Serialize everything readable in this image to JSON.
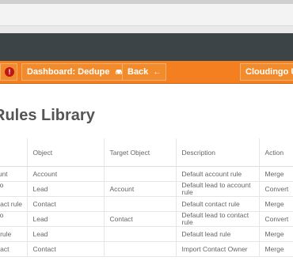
{
  "toolbar": {
    "dashboard_label": "Dashboard: Dedupe",
    "dashboard_icon": "car-icon",
    "dashboard_caret": "▾",
    "back_label": "Back",
    "back_icon": "←",
    "user_label": "Cloudingo Us",
    "alert_glyph": "!",
    "accent_color": "#f47f20"
  },
  "page": {
    "title": "Rules Library"
  },
  "table": {
    "headers": [
      "",
      "Object",
      "Target Object",
      "Description",
      "Action"
    ],
    "rows": [
      {
        "name_lines": [
          "ount"
        ],
        "object": "Account",
        "target": "",
        "description": "Default account rule",
        "action": "Merge"
      },
      {
        "name_lines": [
          "l to",
          "e"
        ],
        "object": "Lead",
        "target": "Account",
        "description": "Default lead to account rule",
        "action": "Convert"
      },
      {
        "name_lines": [
          "ntact rule"
        ],
        "object": "Contact",
        "target": "",
        "description": "Default contact rule",
        "action": "Merge"
      },
      {
        "name_lines": [
          "l to",
          "e"
        ],
        "object": "Lead",
        "target": "Contact",
        "description": "Default lead to contact rule",
        "action": "Convert"
      },
      {
        "name_lines": [
          "d rule"
        ],
        "object": "Lead",
        "target": "",
        "description": "Default lead rule",
        "action": "Merge"
      },
      {
        "name_lines": [
          "ntact"
        ],
        "object": "Contact",
        "target": "",
        "description": "Import Contact Owner",
        "action": "Merge"
      }
    ]
  }
}
